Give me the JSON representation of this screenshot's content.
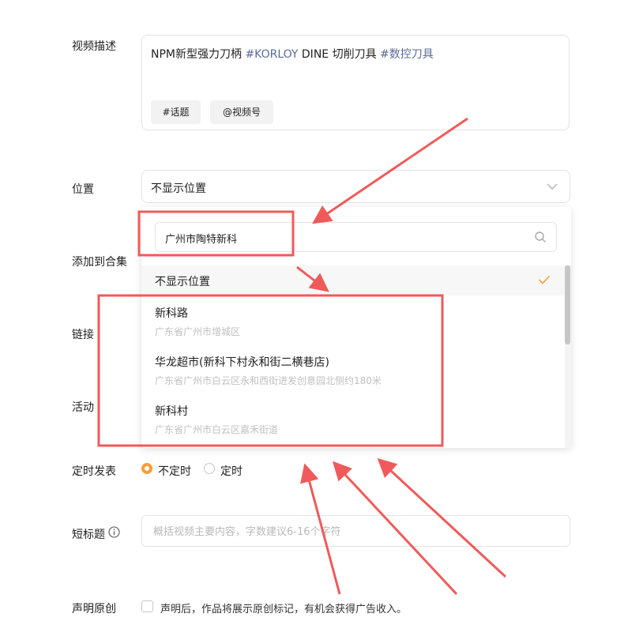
{
  "form": {
    "description": {
      "label": "视频描述",
      "text_plain_1": "NPM新型强力刀柄 ",
      "tag_1": "#KORLOY",
      "text_plain_2": " DINE 切削刀具 ",
      "tag_2": "#数控刀具",
      "chip_topic": "#话题",
      "chip_channel": "@视频号"
    },
    "location": {
      "label": "位置",
      "selected": "不显示位置"
    },
    "collection": {
      "label": "添加到合集"
    },
    "link": {
      "label": "链接"
    },
    "activity": {
      "label": "活动"
    },
    "schedule": {
      "label": "定时发表",
      "option_now": "不定时",
      "option_timed": "定时",
      "selected": "不定时"
    },
    "short_title": {
      "label": "短标题",
      "placeholder": "概括视频主要内容，字数建议6-16个字符"
    },
    "original": {
      "label": "声明原创",
      "text": "声明后，作品将展示原创标记，有机会获得广告收入。",
      "checked": false
    }
  },
  "location_dropdown": {
    "search_value": "广州市陶特新科",
    "none_option": "不显示位置",
    "results": [
      {
        "name": "新科路",
        "address": "广东省广州市增城区"
      },
      {
        "name": "华龙超市(新科下村永和街二横巷店)",
        "address": "广东省广州市白云区永和西街进发创意园北侧约180米"
      },
      {
        "name": "新科村",
        "address": "广东省广州市白云区嘉禾街道"
      }
    ]
  },
  "icons": {
    "chevron": "chevron-down-icon",
    "search": "search-icon",
    "check": "check-icon",
    "info": "info-icon"
  },
  "colors": {
    "accent": "#fa9d3b",
    "tag": "#5b6b95",
    "annotation": "#f05a5a"
  }
}
